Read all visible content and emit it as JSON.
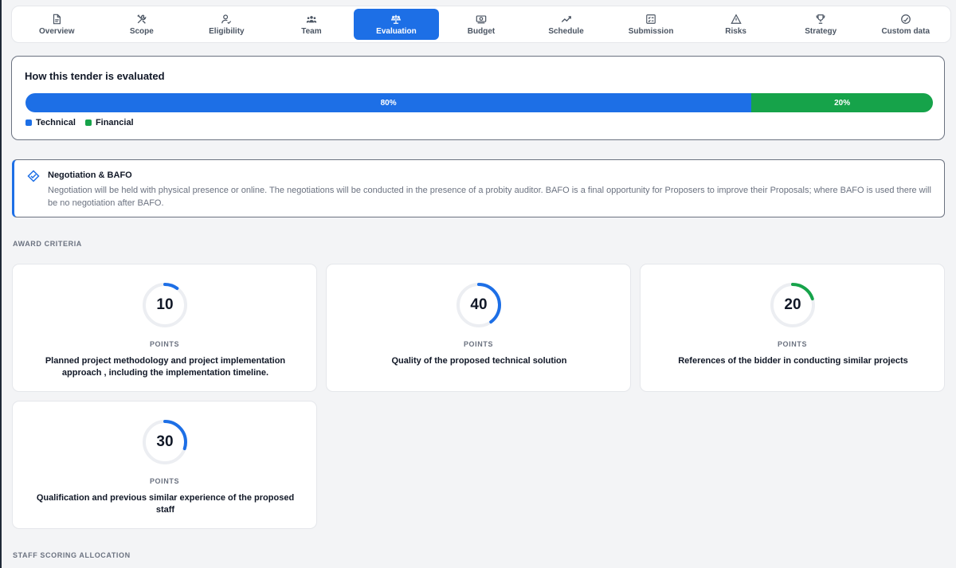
{
  "tabs": [
    {
      "label": "Overview",
      "icon": "document-icon",
      "active": false
    },
    {
      "label": "Scope",
      "icon": "tools-icon",
      "active": false
    },
    {
      "label": "Eligibility",
      "icon": "user-check-icon",
      "active": false
    },
    {
      "label": "Team",
      "icon": "users-icon",
      "active": false
    },
    {
      "label": "Evaluation",
      "icon": "scale-icon",
      "active": true
    },
    {
      "label": "Budget",
      "icon": "money-icon",
      "active": false
    },
    {
      "label": "Schedule",
      "icon": "trend-icon",
      "active": false
    },
    {
      "label": "Submission",
      "icon": "checklist-icon",
      "active": false
    },
    {
      "label": "Risks",
      "icon": "warning-icon",
      "active": false
    },
    {
      "label": "Strategy",
      "icon": "trophy-icon",
      "active": false
    },
    {
      "label": "Custom data",
      "icon": "gauge-icon",
      "active": false
    }
  ],
  "evaluation": {
    "title": "How this tender is evaluated",
    "technical": {
      "label": "Technical",
      "percent_text": "80%",
      "fraction": 0.8,
      "color": "#1d6fe6"
    },
    "financial": {
      "label": "Financial",
      "percent_text": "20%",
      "fraction": 0.2,
      "color": "#16a34a"
    }
  },
  "negotiation": {
    "title": "Negotiation & BAFO",
    "text": "Negotiation will be held with physical presence or online. The negotiations will be conducted in the presence of a probity auditor. BAFO is a final opportunity for Proposers to improve their Proposals; where BAFO is used there will be no negotiation after BAFO."
  },
  "award_criteria": {
    "label": "AWARD CRITERIA",
    "points_label": "POINTS",
    "items": [
      {
        "points": "10",
        "fraction": 0.1,
        "color": "#1d6fe6",
        "text": "Planned project methodology and project implementation approach , including the implementation timeline."
      },
      {
        "points": "40",
        "fraction": 0.4,
        "color": "#1d6fe6",
        "text": "Quality of the proposed technical solution"
      },
      {
        "points": "20",
        "fraction": 0.2,
        "color": "#16a34a",
        "text": "References of the bidder in conducting similar projects"
      },
      {
        "points": "30",
        "fraction": 0.3,
        "color": "#1d6fe6",
        "text": "Qualification and previous similar experience of the proposed staff"
      }
    ]
  },
  "staff_scoring": {
    "label": "STAFF SCORING ALLOCATION"
  }
}
